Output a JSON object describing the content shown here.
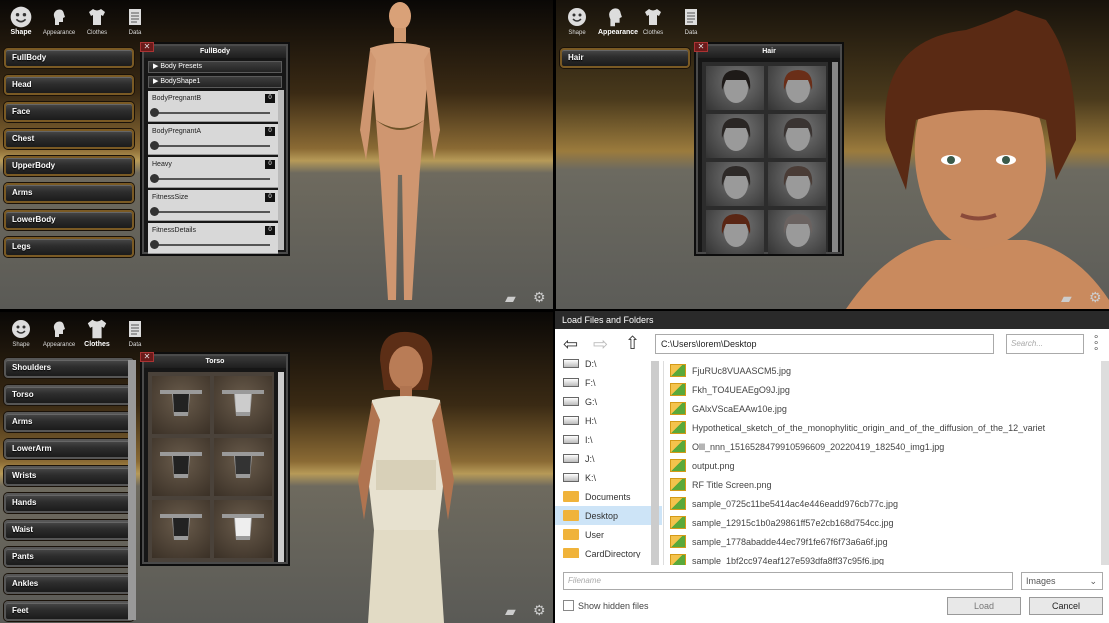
{
  "nav_q1": {
    "items": [
      {
        "label": "Shape"
      },
      {
        "label": "Appearance"
      },
      {
        "label": "Clothes"
      },
      {
        "label": "Data"
      }
    ],
    "selected": 0
  },
  "nav_q2": {
    "items": [
      {
        "label": "Shape"
      },
      {
        "label": "Appearance"
      },
      {
        "label": "Clothes"
      },
      {
        "label": "Data"
      }
    ],
    "selected": 1
  },
  "nav_q3": {
    "items": [
      {
        "label": "Shape"
      },
      {
        "label": "Appearance"
      },
      {
        "label": "Clothes"
      },
      {
        "label": "Data"
      }
    ],
    "selected": 2
  },
  "shape_menu": [
    "FullBody",
    "Head",
    "Face",
    "Chest",
    "UpperBody",
    "Arms",
    "LowerBody",
    "Legs"
  ],
  "fullbody_panel": {
    "title": "FullBody",
    "sections": [
      "Body Presets",
      "BodyShape1"
    ],
    "sliders": [
      {
        "label": "BodyPregnantB",
        "value": "0"
      },
      {
        "label": "BodyPregnantA",
        "value": "0"
      },
      {
        "label": "Heavy",
        "value": "0"
      },
      {
        "label": "FitnessSize",
        "value": "0"
      },
      {
        "label": "FitnessDetails",
        "value": "0"
      }
    ]
  },
  "appearance_menu": [
    "Hair"
  ],
  "hair_panel": {
    "title": "Hair"
  },
  "clothes_menu": [
    "Shoulders",
    "Torso",
    "Arms",
    "LowerArm",
    "Wrists",
    "Hands",
    "Waist",
    "Pants",
    "Ankles",
    "Feet"
  ],
  "torso_panel": {
    "title": "Torso"
  },
  "file_dialog": {
    "title": "Load Files and Folders",
    "path": "C:\\Users\\lorem\\Desktop",
    "search_placeholder": "Search...",
    "locations": [
      {
        "label": "D:\\",
        "kind": "drive"
      },
      {
        "label": "F:\\",
        "kind": "drive"
      },
      {
        "label": "G:\\",
        "kind": "drive"
      },
      {
        "label": "H:\\",
        "kind": "drive"
      },
      {
        "label": "I:\\",
        "kind": "drive"
      },
      {
        "label": "J:\\",
        "kind": "drive"
      },
      {
        "label": "K:\\",
        "kind": "drive"
      },
      {
        "label": "Documents",
        "kind": "folder"
      },
      {
        "label": "Desktop",
        "kind": "folder"
      },
      {
        "label": "User",
        "kind": "folder"
      },
      {
        "label": "CardDirectory",
        "kind": "folder"
      }
    ],
    "selected_location": 8,
    "files": [
      "FjuRUc8VUAASCM5.jpg",
      "Fkh_TO4UEAEgO9J.jpg",
      "GAlxVScaEAAw10e.jpg",
      "Hypothetical_sketch_of_the_monophylitic_origin_and_of_the_diffusion_of_the_12_variet",
      "Olll_nnn_1516528479910596609_20220419_182540_img1.jpg",
      "output.png",
      "RF Title Screen.png",
      "sample_0725c11be5414ac4e446eadd976cb77c.jpg",
      "sample_12915c1b0a29861ff57e2cb168d754cc.jpg",
      "sample_1778abadde44ec79f1fe67f6f73a6a6f.jpg",
      "sample_1bf2cc974eaf127e593dfa8ff37c95f6.jpg"
    ],
    "filename_placeholder": "Filename",
    "filter": "Images",
    "show_hidden": "Show hidden files",
    "load": "Load",
    "cancel": "Cancel"
  }
}
